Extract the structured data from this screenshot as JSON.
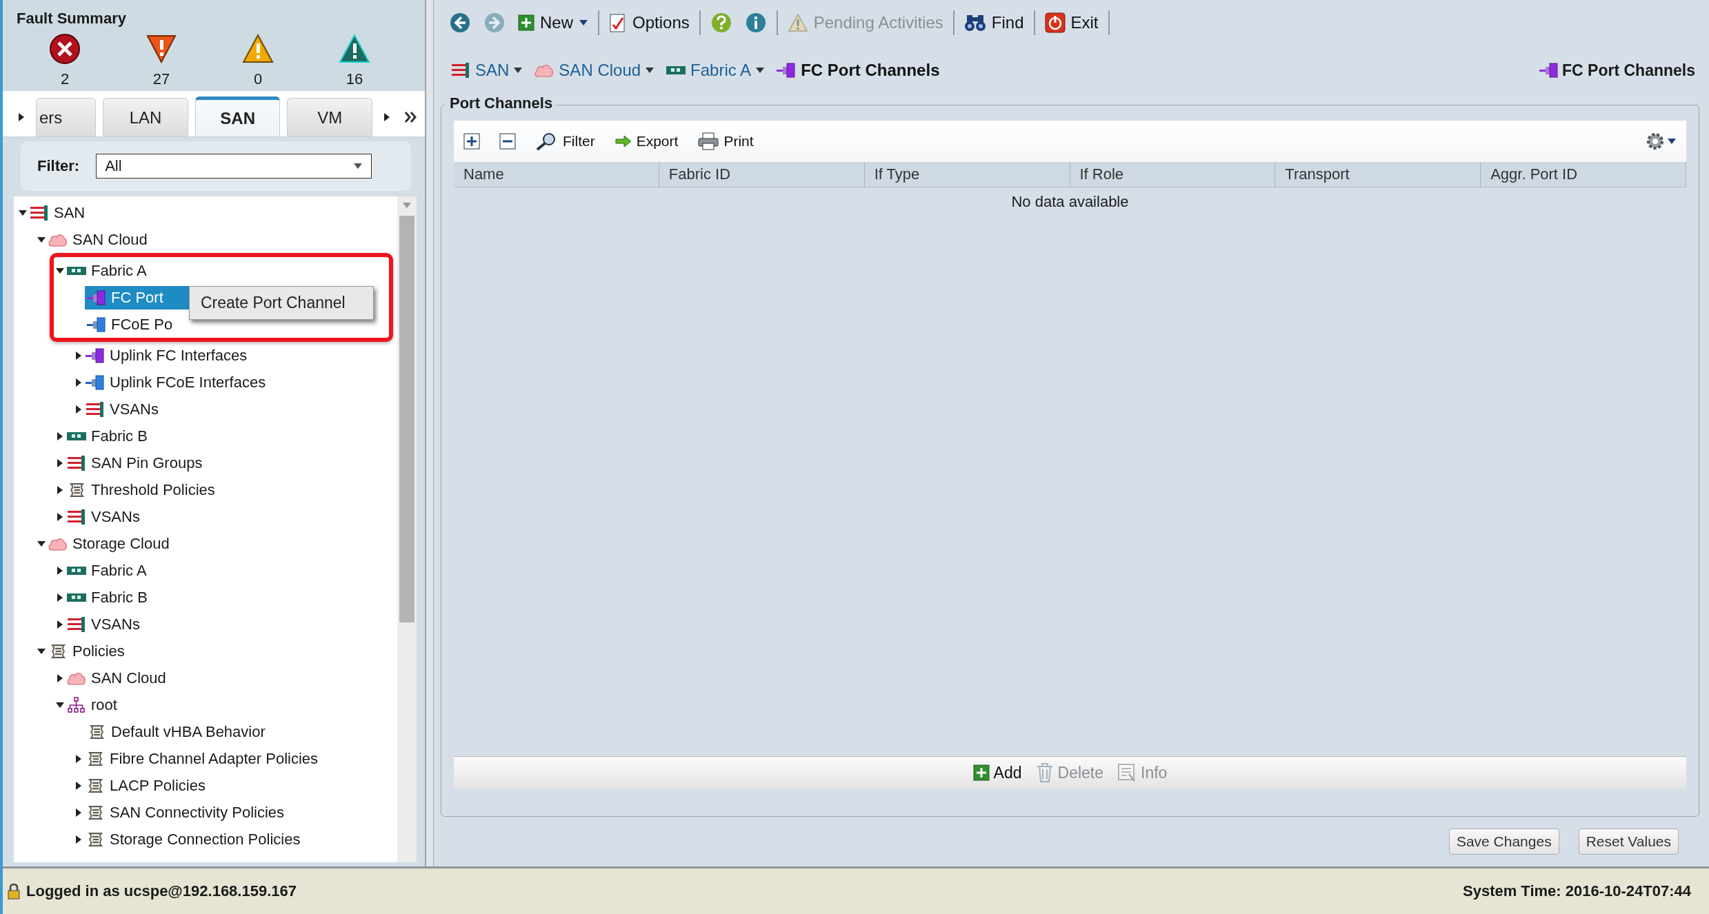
{
  "fault_summary": {
    "title": "Fault Summary",
    "counts": [
      {
        "kind": "critical",
        "count": "2"
      },
      {
        "kind": "major",
        "count": "27"
      },
      {
        "kind": "minor",
        "count": "0"
      },
      {
        "kind": "warning",
        "count": "16"
      }
    ]
  },
  "nav_tabs": [
    {
      "label": "ers",
      "selected": false
    },
    {
      "label": "LAN",
      "selected": false
    },
    {
      "label": "SAN",
      "selected": true
    },
    {
      "label": "VM",
      "selected": false
    }
  ],
  "filter": {
    "label": "Filter:",
    "value": "All"
  },
  "tree": [
    {
      "label": "SAN",
      "kind": "san",
      "expanded": true,
      "selected": false,
      "children": [
        {
          "label": "SAN Cloud",
          "kind": "cloud",
          "expanded": true,
          "selected": false,
          "children": [
            {
              "label": "Fabric A",
              "kind": "fabric",
              "expanded": true,
              "selected": false,
              "highlighted": true,
              "children": [
                {
                  "label": "FC Port",
                  "kind": "fc",
                  "selected": true,
                  "highlighted": true
                },
                {
                  "label": "FCoE Po",
                  "kind": "fcoe",
                  "selected": false,
                  "highlighted": true
                },
                {
                  "label": "Uplink FC Interfaces",
                  "kind": "fc",
                  "expanded": false,
                  "selected": false
                },
                {
                  "label": "Uplink FCoE Interfaces",
                  "kind": "fcoe",
                  "expanded": false,
                  "selected": false
                },
                {
                  "label": "VSANs",
                  "kind": "san",
                  "expanded": false,
                  "selected": false
                }
              ]
            },
            {
              "label": "Fabric B",
              "kind": "fabric",
              "expanded": false,
              "selected": false
            },
            {
              "label": "SAN Pin Groups",
              "kind": "san",
              "expanded": false,
              "selected": false
            },
            {
              "label": "Threshold Policies",
              "kind": "policy",
              "expanded": false,
              "selected": false
            },
            {
              "label": "VSANs",
              "kind": "san",
              "expanded": false,
              "selected": false
            }
          ]
        },
        {
          "label": "Storage Cloud",
          "kind": "cloud",
          "expanded": true,
          "selected": false,
          "children": [
            {
              "label": "Fabric A",
              "kind": "fabric",
              "expanded": false,
              "selected": false
            },
            {
              "label": "Fabric B",
              "kind": "fabric",
              "expanded": false,
              "selected": false
            },
            {
              "label": "VSANs",
              "kind": "san",
              "expanded": false,
              "selected": false
            }
          ]
        },
        {
          "label": "Policies",
          "kind": "policy",
          "expanded": true,
          "selected": false,
          "children": [
            {
              "label": "SAN Cloud",
              "kind": "cloud",
              "expanded": false,
              "selected": false
            },
            {
              "label": "root",
              "kind": "org",
              "expanded": true,
              "selected": false,
              "children": [
                {
                  "label": "Default vHBA Behavior",
                  "kind": "policy",
                  "selected": false
                },
                {
                  "label": "Fibre Channel Adapter Policies",
                  "kind": "policy",
                  "expanded": false,
                  "selected": false
                },
                {
                  "label": "LACP Policies",
                  "kind": "policy",
                  "expanded": false,
                  "selected": false
                },
                {
                  "label": "SAN Connectivity Policies",
                  "kind": "policy",
                  "expanded": false,
                  "selected": false
                },
                {
                  "label": "Storage Connection Policies",
                  "kind": "policy",
                  "expanded": false,
                  "selected": false
                }
              ]
            }
          ]
        }
      ]
    }
  ],
  "context_menu": {
    "items": [
      "Create Port Channel"
    ]
  },
  "toolbar": [
    [
      {
        "kind": "back",
        "disabled": false
      },
      {
        "kind": "forward",
        "disabled": true
      },
      {
        "kind": "new",
        "label": "New",
        "dropdown": true,
        "disabled": false
      }
    ],
    [
      {
        "kind": "options",
        "label": "Options",
        "disabled": false
      }
    ],
    [
      {
        "kind": "help",
        "disabled": false
      },
      {
        "kind": "info",
        "disabled": false
      }
    ],
    [
      {
        "kind": "pending",
        "label": "Pending Activities",
        "disabled": true
      }
    ],
    [
      {
        "kind": "find",
        "label": "Find",
        "disabled": false
      }
    ],
    [
      {
        "kind": "exit",
        "label": "Exit",
        "disabled": false
      }
    ]
  ],
  "breadcrumbs": [
    {
      "label": "SAN",
      "kind": "san",
      "dropdown": true
    },
    {
      "label": "SAN Cloud",
      "kind": "cloud",
      "dropdown": true
    },
    {
      "label": "Fabric A",
      "kind": "fabric",
      "dropdown": true
    },
    {
      "label": "FC Port Channels",
      "kind": "fc",
      "dropdown": false
    }
  ],
  "page_title": {
    "label": "FC Port Channels",
    "kind": "fc"
  },
  "panel": {
    "title": "Port Channels",
    "tools": [
      {
        "kind": "expand"
      },
      {
        "kind": "collapse"
      },
      {
        "kind": "filter",
        "label": "Filter"
      },
      {
        "kind": "export",
        "label": "Export"
      },
      {
        "kind": "print",
        "label": "Print"
      }
    ],
    "columns": [
      "Name",
      "Fabric ID",
      "If Type",
      "If Role",
      "Transport",
      "Aggr. Port ID"
    ],
    "empty_text": "No data available",
    "actions": [
      {
        "kind": "add",
        "label": "Add",
        "disabled": false
      },
      {
        "kind": "delete",
        "label": "Delete",
        "disabled": true
      },
      {
        "kind": "info",
        "label": "Info",
        "disabled": true
      }
    ]
  },
  "buttons": [
    "Save Changes",
    "Reset Values"
  ],
  "status_bar": {
    "user": "Logged in as ucspe@192.168.159.167",
    "time": "System Time: 2016-10-24T07:44"
  }
}
